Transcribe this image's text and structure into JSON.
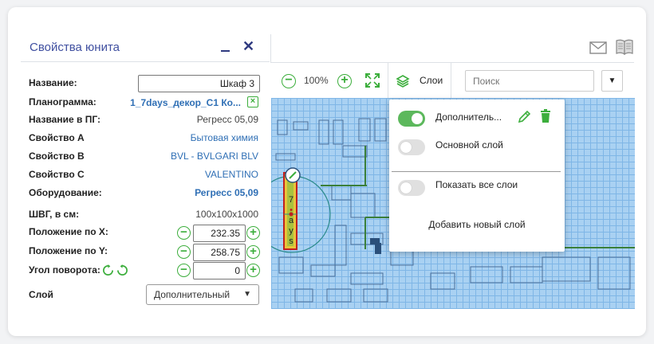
{
  "panel": {
    "title": "Свойства юнита",
    "rows": {
      "name_label": "Название:",
      "name_value": "Шкаф 3",
      "planogram_label": "Планограмма:",
      "planogram_value": "1_7days_декор_C1 Ко...",
      "pg_name_label": "Название в ПГ:",
      "pg_name_value": "Регресс 05,09",
      "prop_a_label": "Свойство А",
      "prop_a_value": "Бытовая химия",
      "prop_b_label": "Свойство B",
      "prop_b_value": "BVL - BVLGARI BLV",
      "prop_c_label": "Свойство C",
      "prop_c_value": "VALENTINO",
      "equipment_label": "Оборудование:",
      "equipment_value": "Регресс 05,09",
      "dims_label": "ШВГ, в см:",
      "dims_value": "100x100x1000",
      "pos_x_label": "Положение по X:",
      "pos_x_value": "232.35",
      "pos_y_label": "Положение по Y:",
      "pos_y_value": "258.75",
      "angle_label": "Угол поворота:",
      "angle_value": "0",
      "layer_label": "Слой",
      "layer_value": "Дополнительный"
    }
  },
  "toolbar": {
    "zoom_level": "100%",
    "layers_label": "Слои",
    "search_placeholder": "Поиск"
  },
  "layers_popup": {
    "layers": [
      {
        "name": "Дополнитель...",
        "enabled": true
      },
      {
        "name": "Основной слой",
        "enabled": false
      }
    ],
    "show_all_label": "Показать все слои",
    "show_all_enabled": false,
    "add_layer_label": "Добавить новый слой"
  },
  "map": {
    "unit_label_chars": [
      "7",
      "•",
      "a",
      "y",
      "s"
    ]
  },
  "colors": {
    "accent_green": "#3cae3c",
    "title_blue": "#3f4fa0",
    "link_blue": "#2f6fb5"
  }
}
